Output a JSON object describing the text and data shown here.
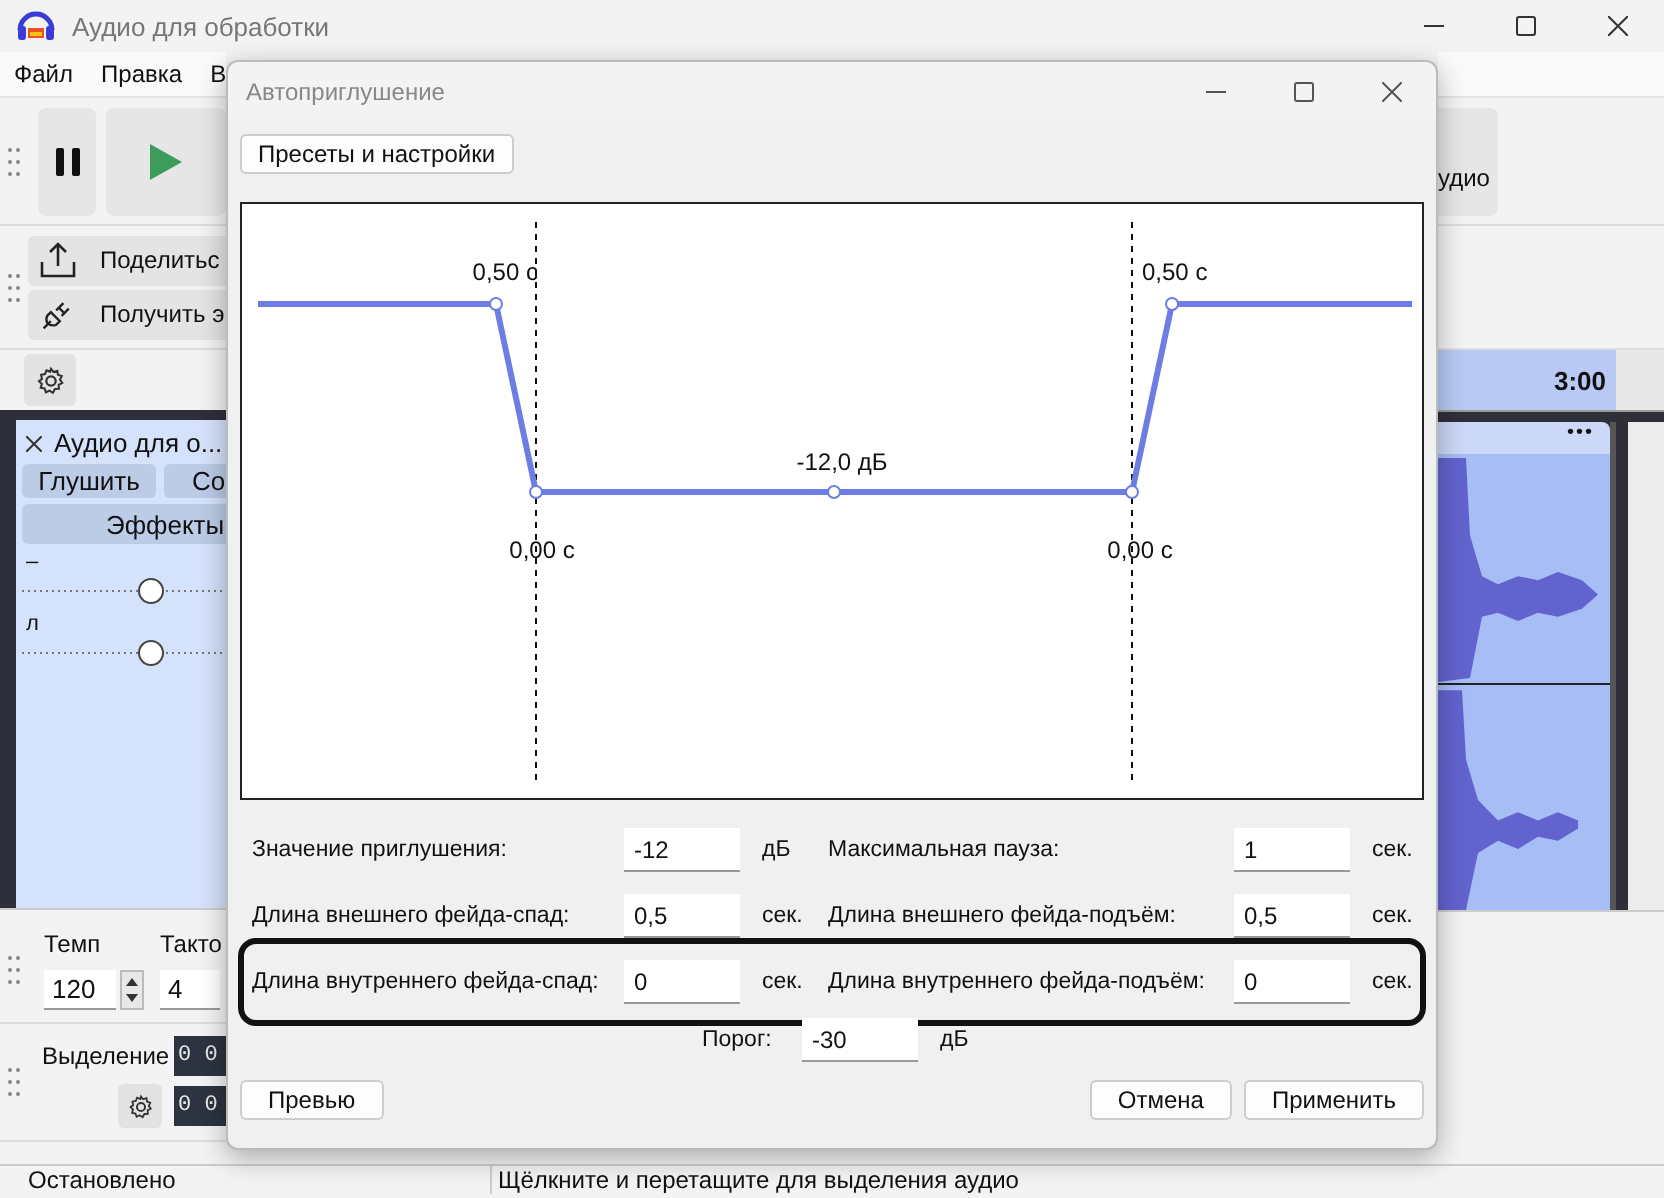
{
  "window": {
    "title": "Аудио для обработки"
  },
  "menu": [
    "Файл",
    "Правка",
    "В"
  ],
  "toolbar": {
    "cut_button": "удио"
  },
  "share_buttons": [
    {
      "kind": "share",
      "label": "Поделитьс"
    },
    {
      "kind": "plugin",
      "label": "Получить э"
    }
  ],
  "ruler": {
    "mark": "3:00"
  },
  "track": {
    "title": "Аудио для о...",
    "buttons": [
      "Глушить",
      "Со"
    ],
    "effects": "Эффекты",
    "menu": "•••",
    "sliders": [
      {
        "label": "–",
        "level": 0.5
      },
      {
        "label": "л",
        "level": 0.5
      }
    ]
  },
  "tempo": {
    "label": "Темп",
    "value": "120"
  },
  "meter": {
    "label": "Такто",
    "value": "4"
  },
  "selection": {
    "label": "Выделение",
    "times": [
      "0 0",
      "0 0"
    ]
  },
  "status_bar": {
    "state": "Остановлено",
    "hint": "Щёлкните и перетащите для выделения аудио"
  },
  "dialog": {
    "title": "Автоприглушение",
    "presets_button": "Пресеты и настройки",
    "graph": {
      "labels": [
        "0,50 с",
        "0,50 с",
        "-12,0 дБ",
        "0,00 с",
        "0,00 с"
      ]
    },
    "rows": [
      {
        "left_label": "Значение приглушения:",
        "left_value": "-12",
        "left_unit": "дБ",
        "right_label": "Максимальная пауза:",
        "right_value": "1",
        "right_unit": "сек.",
        "highlighted": false
      },
      {
        "left_label": "Длина внешнего фейда-спад:",
        "left_value": "0,5",
        "left_unit": "сек.",
        "right_label": "Длина внешнего фейда-подъём:",
        "right_value": "0,5",
        "right_unit": "сек.",
        "highlighted": false
      },
      {
        "left_label": "Длина внутреннего фейда-спад:",
        "left_value": "0",
        "left_unit": "сек.",
        "right_label": "Длина внутреннего фейда-подъём:",
        "right_value": "0",
        "right_unit": "сек.",
        "highlighted": true
      }
    ],
    "threshold": {
      "label": "Порог:",
      "value": "-30",
      "unit": "дБ"
    },
    "buttons": {
      "preview": "Превью",
      "cancel": "Отмена",
      "apply": "Применить"
    }
  }
}
